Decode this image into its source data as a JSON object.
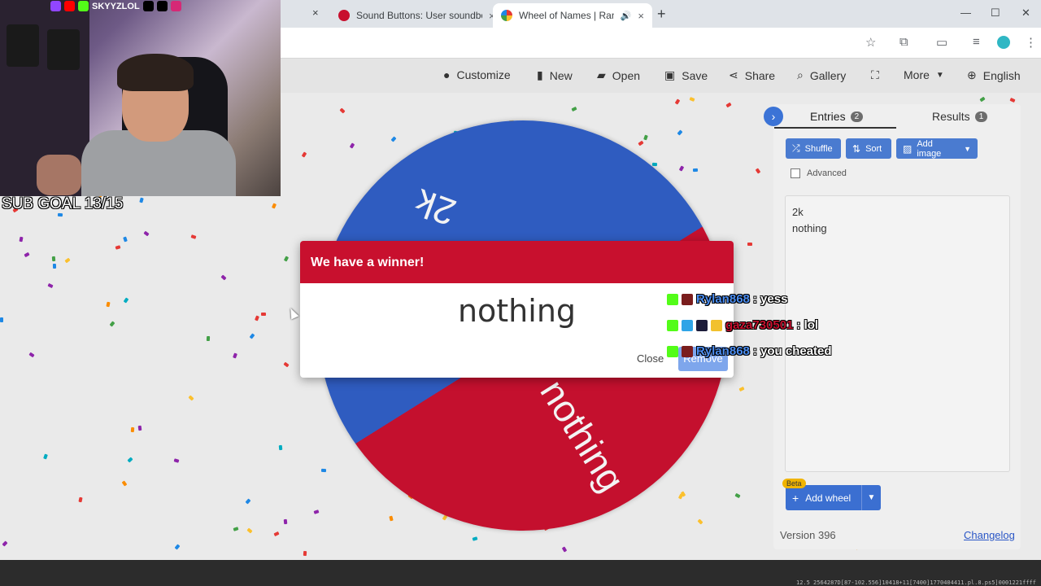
{
  "browser": {
    "tabs": [
      {
        "title": "Sound Buttons: User soundboa",
        "favicon_color": "#c8102e",
        "close": "×"
      },
      {
        "title": "Wheel of Names | Random",
        "favicon_color": "#3b73d6",
        "close": "×",
        "audio": "🔊",
        "active": true
      }
    ],
    "first_tab_close": "×",
    "new_tab": "+",
    "window_controls": {
      "minimize": "—",
      "maximize": "☐",
      "close": "✕"
    }
  },
  "toolbar": {
    "customize": "Customize",
    "new": "New",
    "open": "Open",
    "save": "Save",
    "share": "Share",
    "gallery": "Gallery",
    "more": "More",
    "language": "English"
  },
  "wheel": {
    "segments": [
      {
        "label": "2k",
        "color": "#2f5cc0"
      },
      {
        "label": "nothing",
        "color": "#c4102e"
      }
    ]
  },
  "dialog": {
    "title": "We have a winner!",
    "winner": "nothing",
    "close": "Close",
    "remove": "Remove"
  },
  "sidebar": {
    "tab_entries": "Entries",
    "entries_count": "2",
    "tab_results": "Results",
    "results_count": "1",
    "shuffle": "Shuffle",
    "sort": "Sort",
    "add_image": "Add image",
    "advanced": "Advanced",
    "entries": [
      "2k",
      "nothing"
    ],
    "beta": "Beta",
    "add_wheel": "Add wheel",
    "version": "Version 396",
    "changelog": "Changelog"
  },
  "stream": {
    "channel": "SKYYZLOL",
    "sub_goal": "SUB GOAL 13/15",
    "chat": [
      {
        "user": "Rylan868",
        "user_color": "#4b8df0",
        "message": ": yess"
      },
      {
        "user": "gaza730501",
        "user_color": "#c8102e",
        "message": ": lol"
      },
      {
        "user": "Rylan868",
        "user_color": "#4b8df0",
        "message": ": you cheated"
      }
    ]
  },
  "footer": {
    "stats": "12.5 2564287D[87-102.556]10418+11[7400]1770404411.pl.8.ps5]0001221ffff"
  }
}
